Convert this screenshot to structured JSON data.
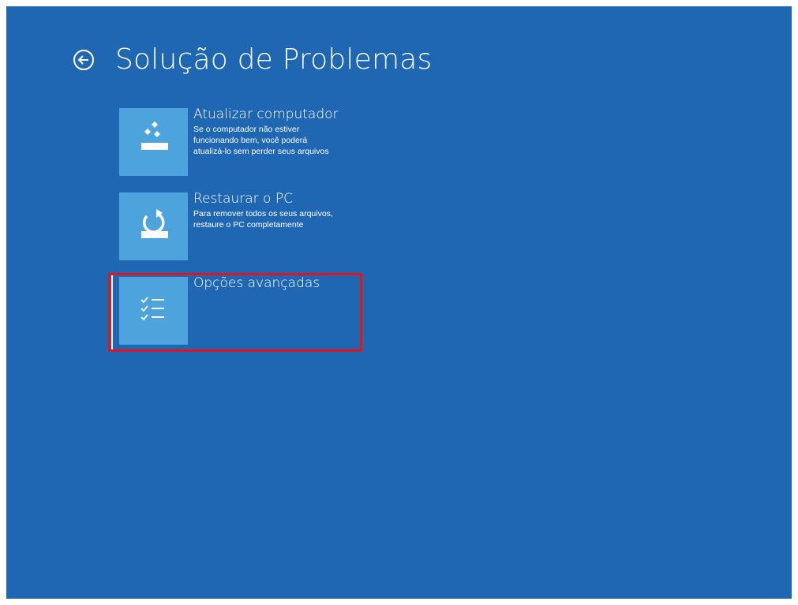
{
  "header": {
    "title": "Solução de Problemas",
    "back_icon": "back-arrow-circle-icon"
  },
  "tiles": [
    {
      "title": "Atualizar computador",
      "description": "Se o computador não estiver\nfuncionando bem, você poderá\natualizá-lo sem perder seus arquivos",
      "icon": "refresh-pc-icon"
    },
    {
      "title": "Restaurar o PC",
      "description": "Para remover todos os seus arquivos,\nrestaure o PC completamente",
      "icon": "reset-pc-icon"
    },
    {
      "title": "Opções avançadas",
      "description": "",
      "icon": "checklist-icon",
      "focused": true
    }
  ],
  "colors": {
    "background": "#2067b3",
    "tile_icon_bg": "#4da3dc",
    "text": "#ffffff",
    "highlight": "#e0151c"
  }
}
